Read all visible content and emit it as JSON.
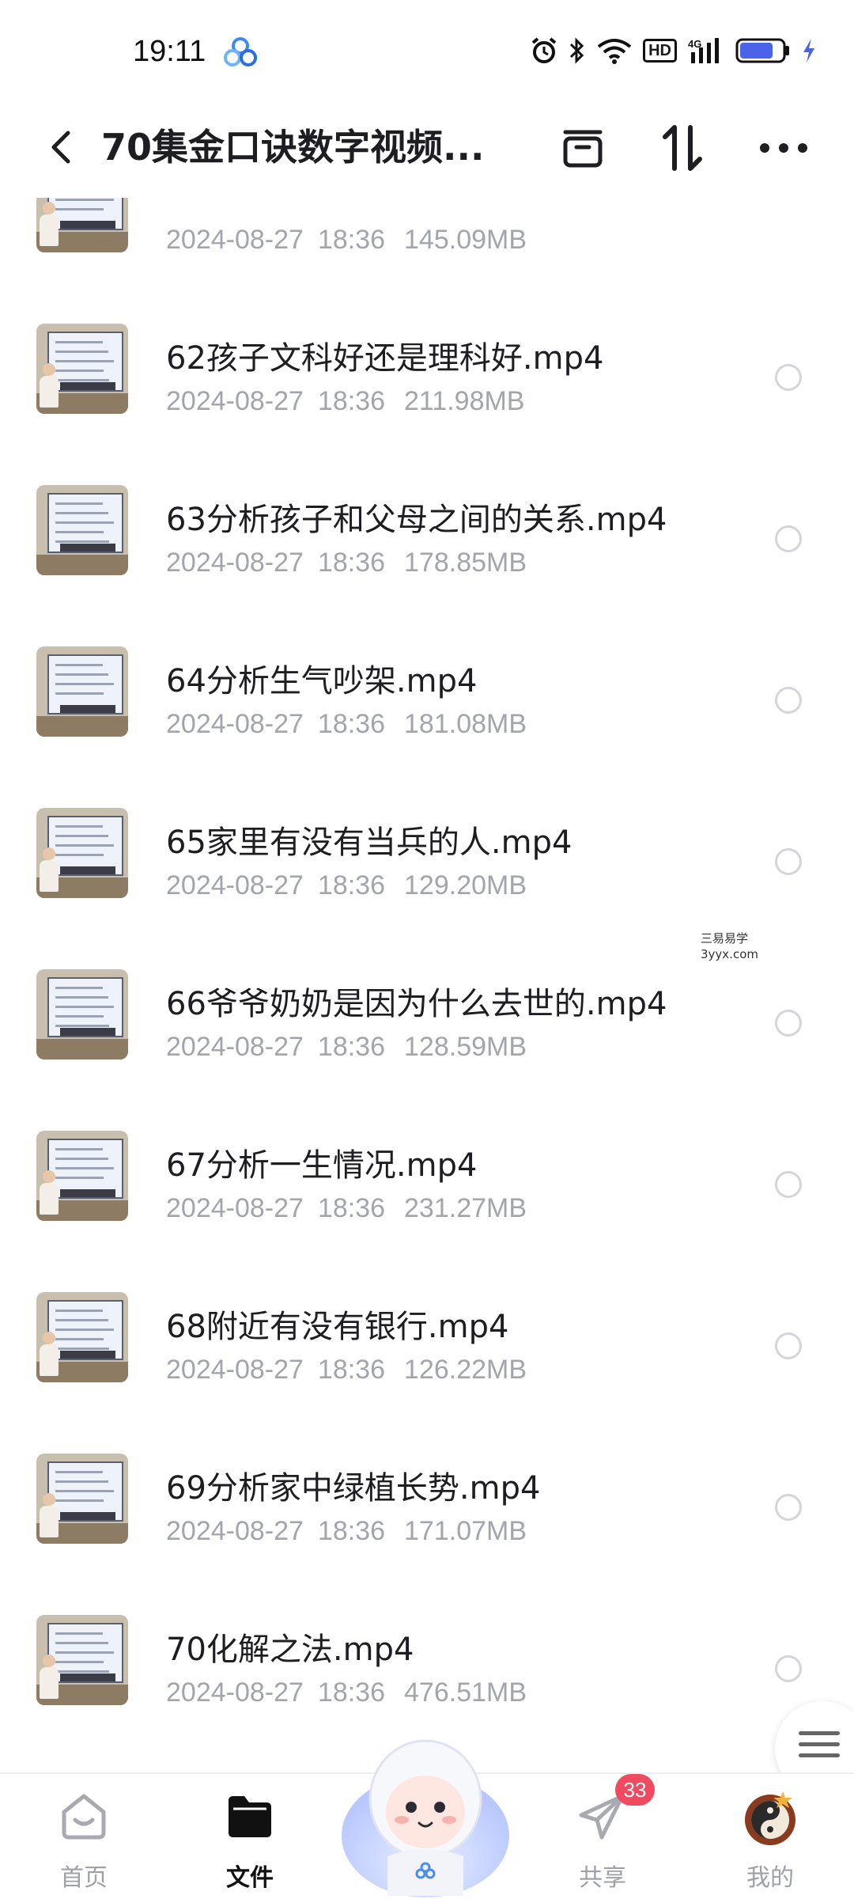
{
  "status_bar": {
    "time": "19:11",
    "network_label": "4G",
    "hd_label": "HD",
    "icons": [
      "app-icon",
      "alarm-icon",
      "bluetooth-icon",
      "wifi-icon",
      "hd-icon",
      "signal-icon",
      "battery-icon",
      "charging-icon"
    ],
    "battery_level_fraction": 0.78
  },
  "header": {
    "title": "70集金口诀数字视频...",
    "icons": [
      "back-icon",
      "archive-icon",
      "sort-icon",
      "more-icon"
    ]
  },
  "files": [
    {
      "name": "",
      "date": "2024-08-27",
      "time": "18:36",
      "size": "145.09MB",
      "partial": true
    },
    {
      "name": "62孩子文科好还是理科好.mp4",
      "date": "2024-08-27",
      "time": "18:36",
      "size": "211.98MB"
    },
    {
      "name": "63分析孩子和父母之间的关系.mp4",
      "date": "2024-08-27",
      "time": "18:36",
      "size": "178.85MB"
    },
    {
      "name": "64分析生气吵架.mp4",
      "date": "2024-08-27",
      "time": "18:36",
      "size": "181.08MB"
    },
    {
      "name": "65家里有没有当兵的人.mp4",
      "date": "2024-08-27",
      "time": "18:36",
      "size": "129.20MB"
    },
    {
      "name": "66爷爷奶奶是因为什么去世的.mp4",
      "date": "2024-08-27",
      "time": "18:36",
      "size": "128.59MB"
    },
    {
      "name": "67分析一生情况.mp4",
      "date": "2024-08-27",
      "time": "18:36",
      "size": "231.27MB"
    },
    {
      "name": "68附近有没有银行.mp4",
      "date": "2024-08-27",
      "time": "18:36",
      "size": "126.22MB"
    },
    {
      "name": "69分析家中绿植长势.mp4",
      "date": "2024-08-27",
      "time": "18:36",
      "size": "171.07MB"
    },
    {
      "name": "70化解之法.mp4",
      "date": "2024-08-27",
      "time": "18:36",
      "size": "476.51MB"
    }
  ],
  "watermark": {
    "line1": "三易易学",
    "line2": "3yyx.com"
  },
  "bottom_nav": {
    "home_label": "首页",
    "files_label": "文件",
    "share_label": "共享",
    "share_badge": "33",
    "mine_label": "我的"
  },
  "colors": {
    "accent_blue": "#4a63e8",
    "badge_red": "#ef4a5f",
    "meta_gray": "#a3a5ac"
  }
}
